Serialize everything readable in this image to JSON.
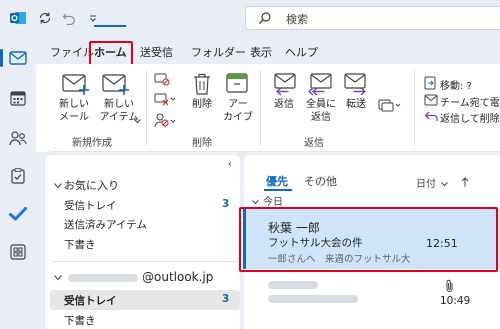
{
  "titlebar": {
    "search_placeholder": "検索",
    "icons": [
      "outlook-app-icon",
      "sync-icon",
      "undo-icon",
      "quick-access-dropdown-icon",
      "search-icon"
    ]
  },
  "rail": {
    "items": [
      "mail-icon",
      "calendar-icon",
      "people-icon",
      "tasks-icon",
      "todo-check-icon",
      "apps-icon"
    ],
    "active": "mail-icon"
  },
  "tabs": {
    "items": [
      "ファイル",
      "ホーム",
      "送受信",
      "フォルダー",
      "表示",
      "ヘルプ"
    ],
    "active": "ホーム"
  },
  "ribbon": {
    "new_mail": "新しい\nメール",
    "new_item": "新しい\nアイテム",
    "new_group": "新規作成",
    "delete": "削除",
    "archive": "アー\nカイブ",
    "delete_group": "削除",
    "reply": "返信",
    "reply_all": "全員に\n返信",
    "forward": "転送",
    "reply_group": "返信",
    "move_to": "移動: ?",
    "team_email": "チーム宛て電子",
    "reply_delete": "返信して削除"
  },
  "folders": {
    "favorites_header": "お気に入り",
    "favorites": [
      {
        "label": "受信トレイ",
        "count": "3"
      },
      {
        "label": "送信済みアイテム",
        "count": ""
      },
      {
        "label": "下書き",
        "count": ""
      }
    ],
    "account": "@outlook.jp",
    "account_folders": [
      {
        "label": "受信トレイ",
        "count": "3",
        "selected": true
      },
      {
        "label": "下書き",
        "count": ""
      }
    ]
  },
  "message_list": {
    "tabs": [
      "優先",
      "その他"
    ],
    "active_tab": "優先",
    "sort_label": "日付",
    "sort_direction_icon": "arrow-up-icon",
    "group_today": "今日",
    "messages": [
      {
        "sender": "秋葉 一郎",
        "subject": "フットサル大会の件",
        "preview": "一郎さんへ　来週のフットサル大",
        "time": "12:51",
        "selected": true
      },
      {
        "time": "10:49",
        "has_attachment": true
      }
    ]
  },
  "colors": {
    "accent": "#0f6cbd",
    "highlight_box": "#e0001b",
    "selected_row": "#cfe4fa",
    "chrome": "#e9eef6"
  }
}
